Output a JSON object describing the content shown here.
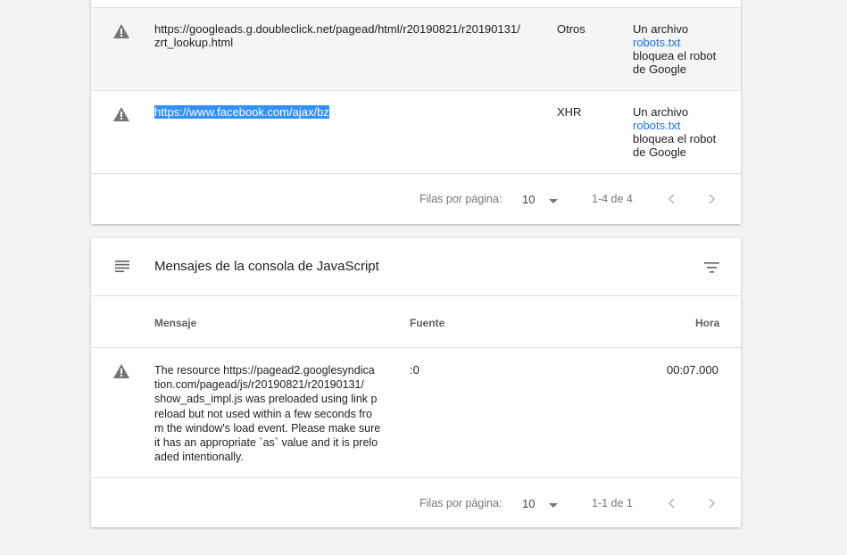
{
  "resources_table": {
    "rows": [
      {
        "url": "https://googleads.g.doubleclick.net/pagead/html/r20190821/r20190131/zrt_lookup.html",
        "url_line1": "https://googleads.g.doubleclick.net/pagead/html/r20190821/r20190131/",
        "url_line2": "zrt_lookup.html",
        "type": "Otros",
        "reason_prefix": "Un archivo",
        "reason_link": "robots.txt",
        "reason_suffix_line1": "bloquea el robot",
        "reason_suffix_line2": "de Google"
      },
      {
        "url": "https://www.facebook.com/ajax/bz",
        "type": "XHR",
        "reason_prefix": "Un archivo",
        "reason_link": "robots.txt",
        "reason_suffix_line1": "bloquea el robot",
        "reason_suffix_line2": "de Google"
      }
    ],
    "pager": {
      "rows_per_page_label": "Filas por página:",
      "rows_per_page_value": "10",
      "range_text": "1-4 de 4"
    }
  },
  "console_card": {
    "title": "Mensajes de la consola de JavaScript",
    "columns": {
      "message": "Mensaje",
      "source": "Fuente",
      "time": "Hora"
    },
    "rows": [
      {
        "message_lines": [
          "The resource https://pagead2.googlesyndica",
          "tion.com/pagead/js/r20190821/r20190131/",
          "show_ads_impl.js was preloaded using link p",
          "reload but not used within a few seconds fro",
          "m the window's load event. Please make sure",
          "it has an appropriate `as` value and it is prelo",
          "aded intentionally."
        ],
        "source": ":0",
        "time": "00:07.000"
      }
    ],
    "pager": {
      "rows_per_page_label": "Filas por página:",
      "rows_per_page_value": "10",
      "range_text": "1-1 de 1"
    }
  },
  "icons": {
    "warning": "warning-icon",
    "list": "list-icon",
    "filter": "filter-icon",
    "prev": "chevron-left-icon",
    "next": "chevron-right-icon"
  },
  "colors": {
    "link": "#1a73e8",
    "selection": "#3390ff",
    "row_alt": "#f5f5f5"
  }
}
